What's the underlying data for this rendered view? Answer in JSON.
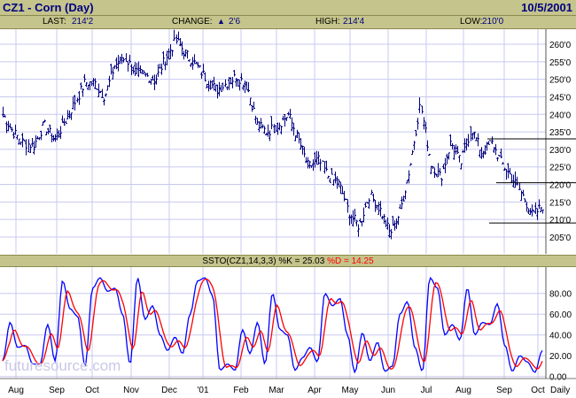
{
  "header": {
    "title": "CZ1 - Corn (Day)",
    "date": "10/5/2001"
  },
  "info": {
    "last_label": "LAST:",
    "last": "214'2",
    "change_label": "CHANGE:",
    "change": "2'6",
    "change_dir": "up",
    "high_label": "HIGH:",
    "high": "214'4",
    "low_label": "LOW:",
    "low": "210'0"
  },
  "indicator": {
    "label": "SSTO(CZ1,14,3,3) %K = 25.03",
    "d_label": "%D = 14.25",
    "k_color": "#0000ff",
    "d_color": "#ff0000"
  },
  "watermark": "futuresource.com",
  "chart_data": [
    {
      "type": "ohlc",
      "title": "CZ1 - Corn (Day)",
      "ylim": [
        202,
        264
      ],
      "yticks": [
        205,
        210,
        215,
        220,
        225,
        230,
        235,
        240,
        245,
        250,
        255,
        260
      ],
      "ytick_labels": [
        "205'0",
        "210'0",
        "215'0",
        "220'0",
        "225'0",
        "230'0",
        "235'0",
        "240'0",
        "245'0",
        "250'0",
        "255'0",
        "260'0"
      ],
      "x_categories": [
        "Aug",
        "Sep",
        "Oct",
        "Nov",
        "Dec",
        "'01",
        "Feb",
        "Mar",
        "Apr",
        "May",
        "Jun",
        "Jul",
        "Aug",
        "Sep",
        "Oct"
      ],
      "x_period_label": "Daily",
      "approx_close_path": [
        240,
        235,
        232,
        231,
        237,
        233,
        237,
        243,
        249,
        249,
        245,
        254,
        256,
        252,
        251,
        250,
        256,
        261,
        257,
        254,
        250,
        247,
        249,
        251,
        248,
        237,
        235,
        237,
        240,
        233,
        225,
        227,
        222,
        220,
        212,
        208,
        217,
        213,
        206,
        212,
        225,
        243,
        226,
        222,
        232,
        226,
        236,
        229,
        232,
        226,
        222,
        217,
        211,
        214
      ],
      "horizontal_lines": [
        233,
        220.5,
        209
      ],
      "color": "#000080"
    },
    {
      "type": "line",
      "title": "SSTO(CZ1,14,3,3)",
      "ylim": [
        0,
        100
      ],
      "yticks": [
        0,
        20,
        40,
        60,
        80
      ],
      "ytick_labels": [
        "0.00",
        "20.00",
        "40.00",
        "60.00",
        "80.00"
      ],
      "series": [
        {
          "name": "%K",
          "values": [
            15,
            52,
            28,
            30,
            12,
            12,
            50,
            15,
            92,
            65,
            58,
            10,
            85,
            95,
            82,
            85,
            60,
            12,
            95,
            55,
            68,
            40,
            25,
            38,
            22,
            60,
            92,
            95,
            78,
            6,
            12,
            6,
            45,
            22,
            52,
            12,
            80,
            45,
            40,
            6,
            18,
            28,
            14,
            80,
            68,
            75,
            40,
            4,
            42,
            15,
            33,
            5,
            10,
            60,
            72,
            28,
            5,
            95,
            85,
            40,
            50,
            35,
            85,
            40,
            52,
            50,
            70,
            30,
            5,
            20,
            14,
            4,
            25.03
          ]
        },
        {
          "name": "%D",
          "smoothing": 3
        }
      ]
    }
  ]
}
